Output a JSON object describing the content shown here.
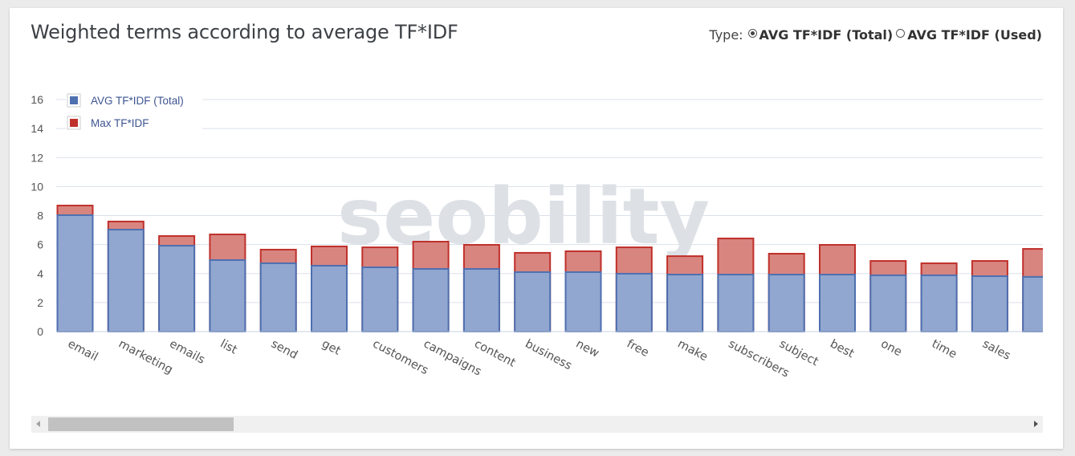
{
  "page": {
    "title": "Weighted terms according to average TF*IDF",
    "type_label": "Type:",
    "type_options": [
      {
        "label": "AVG TF*IDF (Total)",
        "selected": true
      },
      {
        "label": "AVG TF*IDF (Used)",
        "selected": false
      }
    ],
    "watermark": "seobility",
    "scrollbar": {
      "position_fraction": 0.0,
      "visible_fraction": 0.19
    }
  },
  "colors": {
    "avg_fill": "#91a7cf",
    "avg_stroke": "#4e6fb0",
    "max_fill": "#d88580",
    "max_stroke": "#c0302b",
    "grid": "#dbe0ea",
    "watermark": "#dde1e6"
  },
  "chart_data": {
    "type": "bar",
    "mode": "overlapped",
    "title": "Weighted terms according to average TF*IDF",
    "xlabel": "",
    "ylabel": "",
    "ylim": [
      0,
      16
    ],
    "yticks": [
      0,
      2,
      4,
      6,
      8,
      10,
      12,
      14,
      16
    ],
    "grid": true,
    "legend_position": "top-left",
    "categories": [
      "email",
      "marketing",
      "emails",
      "list",
      "send",
      "get",
      "customers",
      "campaigns",
      "content",
      "business",
      "new",
      "free",
      "make",
      "subscribers",
      "subject",
      "best",
      "one",
      "time",
      "sales",
      ""
    ],
    "series": [
      {
        "name": "AVG TF*IDF (Total)",
        "values": [
          8.03,
          7.03,
          5.92,
          4.93,
          4.71,
          4.54,
          4.43,
          4.32,
          4.32,
          4.1,
          4.1,
          3.99,
          3.93,
          3.93,
          3.93,
          3.93,
          3.88,
          3.88,
          3.82,
          3.77
        ]
      },
      {
        "name": "Max TF*IDF",
        "values": [
          8.69,
          7.59,
          6.59,
          6.7,
          5.65,
          5.87,
          5.81,
          6.2,
          5.98,
          5.43,
          5.54,
          5.81,
          5.2,
          6.42,
          5.37,
          5.98,
          4.87,
          4.71,
          4.87,
          5.7
        ]
      }
    ]
  }
}
